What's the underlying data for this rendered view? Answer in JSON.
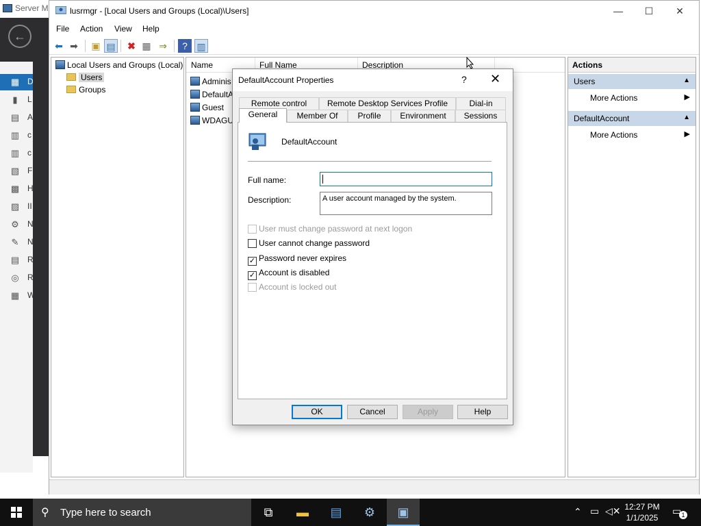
{
  "server_manager": {
    "title": "Server Ma",
    "nav": [
      {
        "icon": "dashboard-icon",
        "glyph": "▦",
        "label": "D"
      },
      {
        "icon": "local-server-icon",
        "glyph": "▮",
        "label": "L"
      },
      {
        "icon": "all-servers-icon",
        "glyph": "▤",
        "label": "A"
      },
      {
        "icon": "server-role-icon",
        "glyph": "▥",
        "label": "c"
      },
      {
        "icon": "server-role-icon",
        "glyph": "▥",
        "label": "c"
      },
      {
        "icon": "file-services-icon",
        "glyph": "▧",
        "label": "F"
      },
      {
        "icon": "hyperv-icon",
        "glyph": "▩",
        "label": "H"
      },
      {
        "icon": "iis-icon",
        "glyph": "▨",
        "label": "II"
      },
      {
        "icon": "network-icon",
        "glyph": "⚙",
        "label": "N"
      },
      {
        "icon": "tools-icon",
        "glyph": "✎",
        "label": "N"
      },
      {
        "icon": "remote-access-icon",
        "glyph": "▤",
        "label": "R"
      },
      {
        "icon": "remote-desktop-icon",
        "glyph": "◎",
        "label": "R"
      },
      {
        "icon": "wsus-icon",
        "glyph": "▦",
        "label": "W"
      }
    ]
  },
  "lusrmgr": {
    "title": "lusrmgr - [Local Users and Groups (Local)\\Users]",
    "menu": [
      "File",
      "Action",
      "View",
      "Help"
    ],
    "tree": {
      "root": "Local Users and Groups (Local)",
      "children": [
        "Users",
        "Groups"
      ],
      "selected": "Users"
    },
    "columns": [
      "Name",
      "Full Name",
      "Description"
    ],
    "users": [
      "Adminis",
      "DefaultA",
      "Guest",
      "WDAGUt"
    ],
    "actions": {
      "header": "Actions",
      "sections": [
        {
          "title": "Users",
          "items": [
            "More Actions"
          ]
        },
        {
          "title": "DefaultAccount",
          "items": [
            "More Actions"
          ]
        }
      ]
    }
  },
  "dialog": {
    "title": "DefaultAccount Properties",
    "help_glyph": "?",
    "close_glyph": "✕",
    "tabs_top": [
      "Remote control",
      "Remote Desktop Services Profile",
      "Dial-in"
    ],
    "tabs_bottom": [
      "General",
      "Member Of",
      "Profile",
      "Environment",
      "Sessions"
    ],
    "active_tab": "General",
    "account_name": "DefaultAccount",
    "full_name_label": "Full name:",
    "full_name_value": "",
    "description_label": "Description:",
    "description_value": "A user account managed by the system.",
    "checkboxes": [
      {
        "label": "User must change password at next logon",
        "checked": false,
        "disabled": true
      },
      {
        "label": "User cannot change password",
        "checked": false,
        "disabled": false
      },
      {
        "label": "Password never expires",
        "checked": true,
        "disabled": false
      },
      {
        "label": "Account is disabled",
        "checked": true,
        "disabled": false
      },
      {
        "label": "Account is locked out",
        "checked": false,
        "disabled": true
      }
    ],
    "buttons": {
      "ok": "OK",
      "cancel": "Cancel",
      "apply": "Apply",
      "help": "Help"
    }
  },
  "taskbar": {
    "search_placeholder": "Type here to search",
    "time": "12:27 PM",
    "date": "1/1/2025",
    "notification_count": "1"
  }
}
